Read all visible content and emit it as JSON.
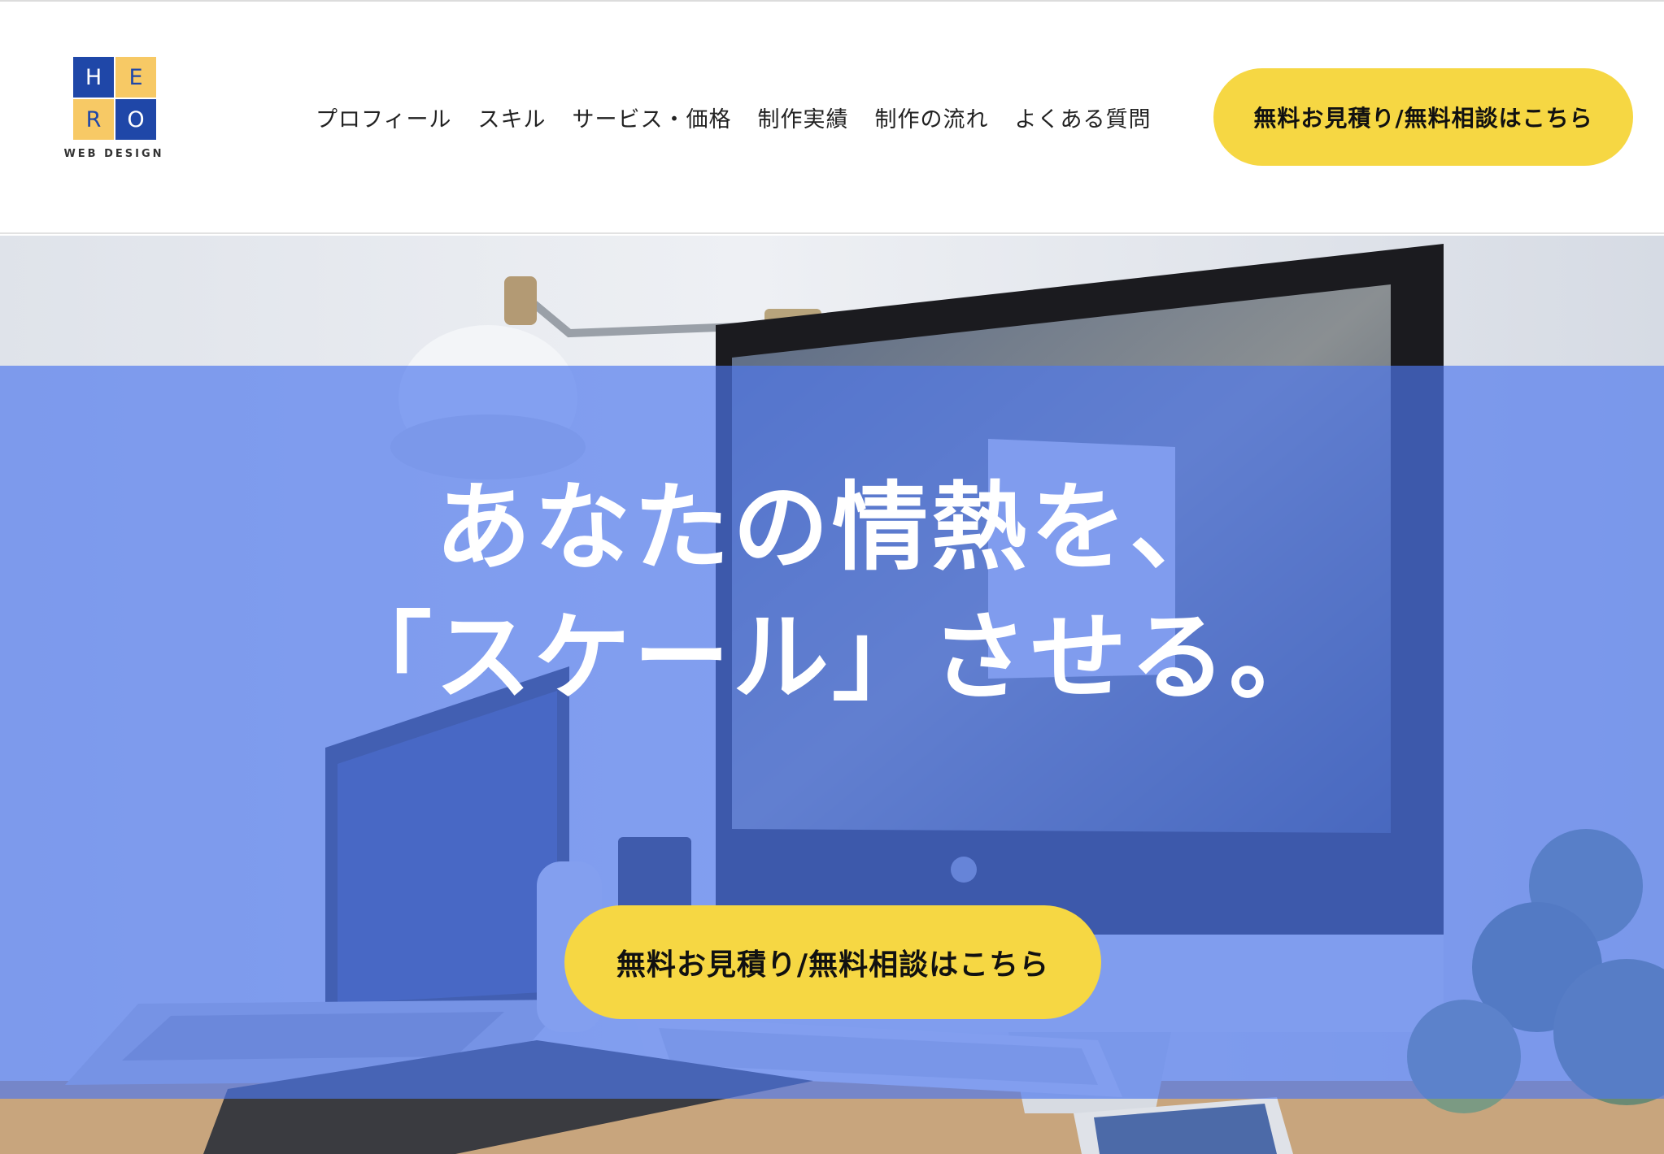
{
  "header": {
    "logo": {
      "letters": [
        "H",
        "E",
        "R",
        "O"
      ],
      "caption": "WEB DESIGN",
      "colors": {
        "blue": "#1f47a8",
        "yellow": "#f7c965"
      }
    },
    "nav": [
      {
        "label": "プロフィール"
      },
      {
        "label": "スキル"
      },
      {
        "label": "サービス・価格"
      },
      {
        "label": "制作実績"
      },
      {
        "label": "制作の流れ"
      },
      {
        "label": "よくある質問"
      }
    ],
    "cta_label": "無料お見積り/無料相談はこちら"
  },
  "hero": {
    "headline_line1": "あなたの情熱を、",
    "headline_line2": "「スケール」させる。",
    "cta_label": "無料お見積り/無料相談はこちら",
    "background_icons": [
      "desk-lamp-icon",
      "imac-icon",
      "laptop-icon",
      "keyboard-icon",
      "phone-icon",
      "plant-icon"
    ]
  },
  "colors": {
    "accent_yellow": "#f6d743",
    "overlay_blue": "#4e78ee",
    "text_dark": "#222222"
  }
}
